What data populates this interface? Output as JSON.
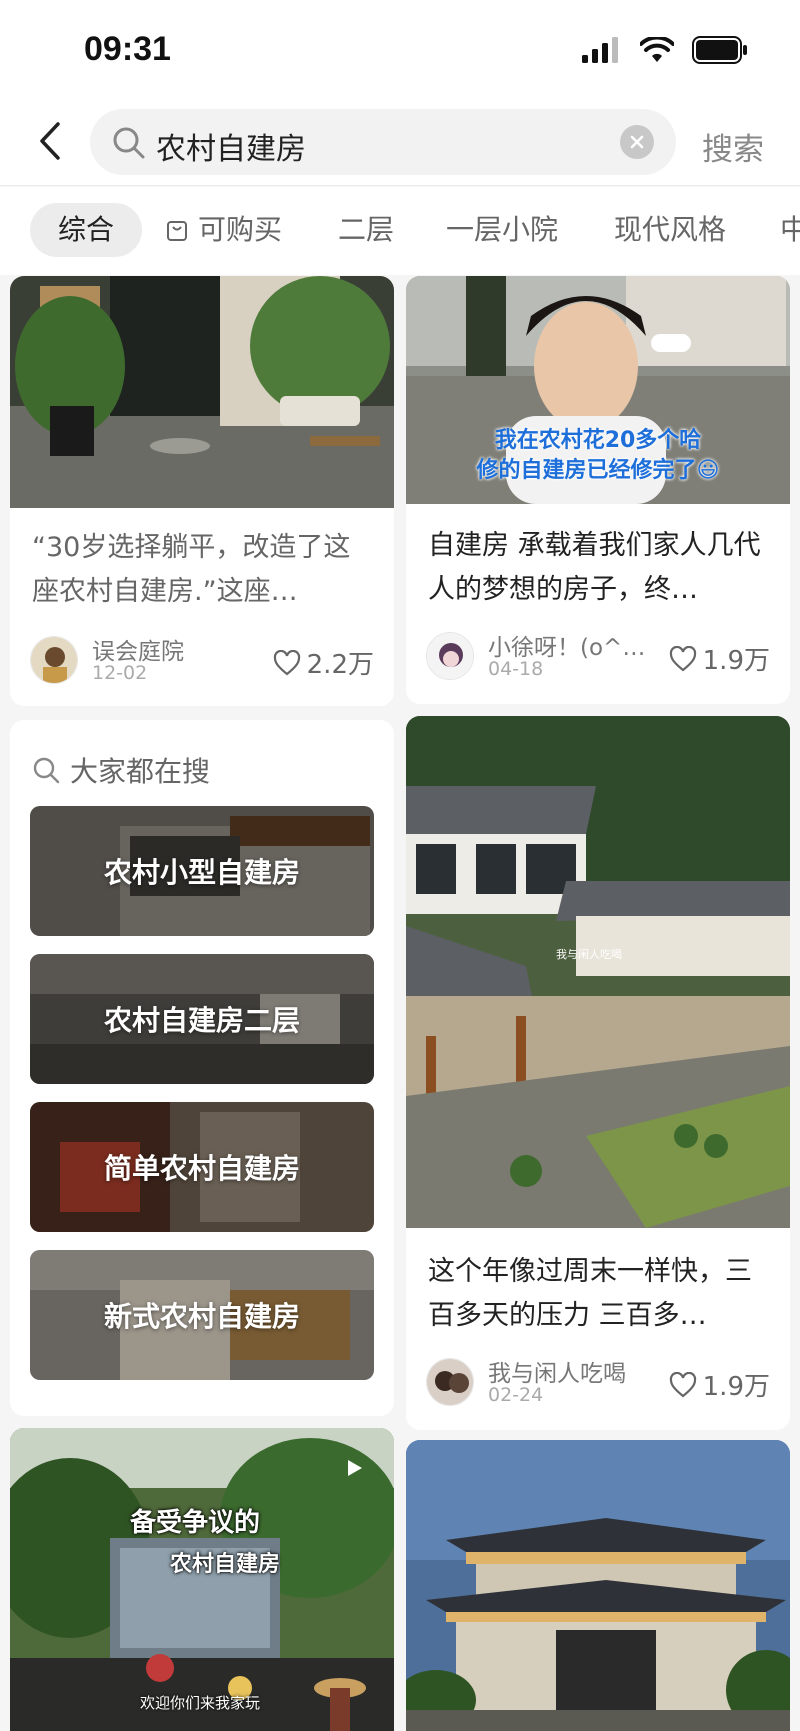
{
  "status": {
    "time": "09:31"
  },
  "search": {
    "query": "农村自建房",
    "button": "搜索"
  },
  "tabs": [
    "综合",
    "可购买",
    "二层",
    "一层小院",
    "现代风格",
    "中"
  ],
  "cards": [
    {
      "title": "“30岁选择躺平，改造了这座农村自建房.”这座…",
      "author": "误会庭院",
      "date": "12-02",
      "likes": "2.2万"
    },
    {
      "title": "自建房 承载着我们家人几代人的梦想的房子，终…",
      "author": "小徐呀！(o^…",
      "date": "04-18",
      "likes": "1.9万",
      "overlay": "我在农村花20多个哈\n修的自建房已经修完了😃"
    },
    {
      "title": "这个年像过周末一样快，三百多天的压力 三百多…",
      "author": "我与闲人吃喝",
      "date": "02-24",
      "likes": "1.9万",
      "watermark": "我与闲人吃喝"
    },
    {
      "overlay1": "备受争议的",
      "overlay2": "农村自建房",
      "caption": "欢迎你们来我家玩"
    }
  ],
  "suggestions": {
    "title": "大家都在搜",
    "items": [
      "农村小型自建房",
      "农村自建房二层",
      "简单农村自建房",
      "新式农村自建房"
    ]
  }
}
